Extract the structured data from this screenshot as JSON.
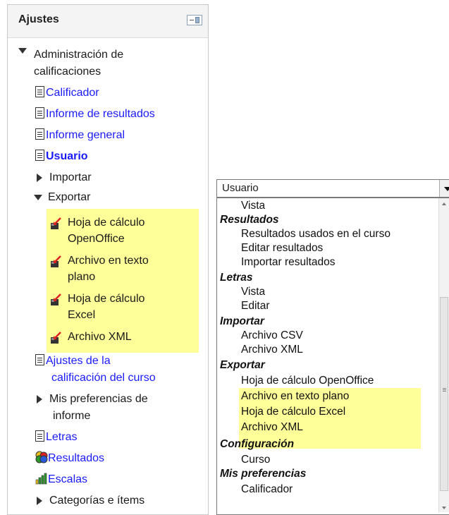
{
  "block": {
    "title": "Ajustes",
    "admin_label_line1": "Administración de",
    "admin_label_line2": "calificaciones",
    "links": {
      "calificador": "Calificador",
      "informe_resultados": "Informe de resultados",
      "informe_general": "Informe general",
      "usuario": "Usuario"
    },
    "importar": "Importar",
    "exportar": "Exportar",
    "export_items": {
      "oo_line1": "Hoja de cálculo",
      "oo_line2": "OpenOffice",
      "txt_line1": "Archivo en texto",
      "txt_line2": "plano",
      "excel_line1": "Hoja de cálculo",
      "excel_line2": "Excel",
      "xml": "Archivo XML"
    },
    "ajustes_line1": "Ajustes de la",
    "ajustes_line2": "calificación del curso",
    "mis_pref_line1": "Mis preferencias de",
    "mis_pref_line2": "informe",
    "letras": "Letras",
    "resultados": "Resultados",
    "escalas": "Escalas",
    "categorias": "Categorías e ítems",
    "icons": {
      "doc": "document-icon",
      "export": "export-icon",
      "results": "results-icon",
      "scales": "scales-icon"
    },
    "highlight_color": "#ffff99"
  },
  "dropdown": {
    "selected": "Usuario",
    "options": {
      "vista1": "Vista",
      "g_resultados": "Resultados",
      "res_usados": "Resultados usados en el curso",
      "editar_res": "Editar resultados",
      "importar_res": "Importar resultados",
      "g_letras": "Letras",
      "vista2": "Vista",
      "editar": "Editar",
      "g_importar": "Importar",
      "csv": "Archivo CSV",
      "xml1": "Archivo XML",
      "g_exportar": "Exportar",
      "oo": "Hoja de cálculo OpenOffice",
      "txt": "Archivo en texto plano",
      "excel": "Hoja de cálculo Excel",
      "xml2": "Archivo XML",
      "g_config": "Configuración",
      "curso": "Curso",
      "g_mispref": "Mis preferencias",
      "calificador": "Calificador"
    }
  }
}
